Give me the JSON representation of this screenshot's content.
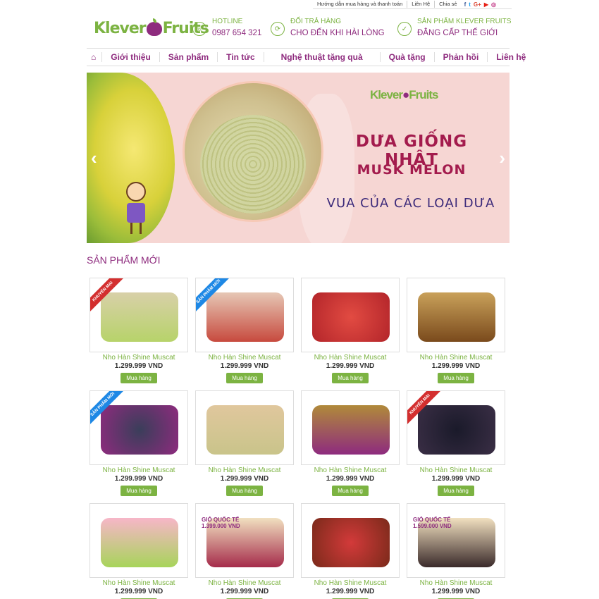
{
  "topbar": {
    "links": [
      "Hướng dẫn mua hàng và thanh toán",
      "Liên Hệ",
      "Chia sẻ"
    ],
    "social": [
      "f",
      "t",
      "G+",
      "▶",
      "◎"
    ]
  },
  "header": {
    "logo_left": "Klever",
    "logo_right": "Fruits",
    "hotline_label": "HOTLINE",
    "hotline_value": "0987 654 321",
    "return_label": "ĐỔI TRẢ HÀNG",
    "return_value": "CHO ĐẾN KHI HÀI LÒNG",
    "product_label": "SẢN PHẨM KLEVER FRUITS",
    "product_value": "ĐẲNG CẤP THẾ GIỚI"
  },
  "nav": {
    "home_icon": "home-icon",
    "items": [
      "Giới thiệu",
      "Sản phẩm",
      "Tin tức",
      "Nghệ thuật tặng quà",
      "Quà tặng",
      "Phản hồi",
      "Liên hệ"
    ]
  },
  "banner": {
    "logo_left": "Klever",
    "logo_right": "Fruits",
    "line1": "DƯA GIỐNG NHẬT",
    "line2": "MUSK MELON",
    "line3": "VUA CỦA CÁC LOẠI DƯA",
    "prev": "‹",
    "next": "›"
  },
  "section": {
    "title": "SẢN PHẨM MỚI"
  },
  "colors": {
    "brand_purple": "#8e2b7e",
    "brand_green": "#7cb342",
    "ribbon_red": "#d32f2f",
    "ribbon_blue": "#1e88e5"
  },
  "products": [
    {
      "name": "Nho Hàn Shine Muscat",
      "price": "1.299.999 VND",
      "button": "Mua hàng",
      "ribbon": "KHUYẾN MẠI"
    },
    {
      "name": "Nho Hàn Shine Muscat",
      "price": "1.299.999 VND",
      "button": "Mua hàng",
      "ribbon": "SẢN PHẨM MỚI"
    },
    {
      "name": "Nho Hàn Shine Muscat",
      "price": "1.299.999 VND",
      "button": "Mua hàng",
      "ribbon": ""
    },
    {
      "name": "Nho Hàn Shine Muscat",
      "price": "1.299.999 VND",
      "button": "Mua hàng",
      "ribbon": ""
    },
    {
      "name": "Nho Hàn Shine Muscat",
      "price": "1.299.999 VND",
      "button": "Mua hàng",
      "ribbon": "SẢN PHẨM MỚI"
    },
    {
      "name": "Nho Hàn Shine Muscat",
      "price": "1.299.999 VND",
      "button": "Mua hàng",
      "ribbon": ""
    },
    {
      "name": "Nho Hàn Shine Muscat",
      "price": "1.299.999 VND",
      "button": "Mua hàng",
      "ribbon": ""
    },
    {
      "name": "Nho Hàn Shine Muscat",
      "price": "1.299.999 VND",
      "button": "Mua hàng",
      "ribbon": "KHUYẾN MẠI"
    },
    {
      "name": "Nho Hàn Shine Muscat",
      "price": "1.299.999 VND",
      "button": "Mua hàng",
      "ribbon": ""
    },
    {
      "name": "Nho Hàn Shine Muscat",
      "price": "1.299.999 VND",
      "button": "Mua hàng",
      "ribbon": ""
    },
    {
      "name": "Nho Hàn Shine Muscat",
      "price": "1.299.999 VND",
      "button": "Mua hàng",
      "ribbon": ""
    },
    {
      "name": "Nho Hàn Shine Muscat",
      "price": "1.299.999 VND",
      "button": "Mua hàng",
      "ribbon": ""
    }
  ],
  "product_image_texts": [
    "",
    "",
    "",
    "",
    "",
    "",
    "",
    "",
    "",
    "GIỎ QUỐC TẾ 1.399.000 VND",
    "",
    "GIỎ QUỐC TẾ 1.599.000 VND"
  ]
}
